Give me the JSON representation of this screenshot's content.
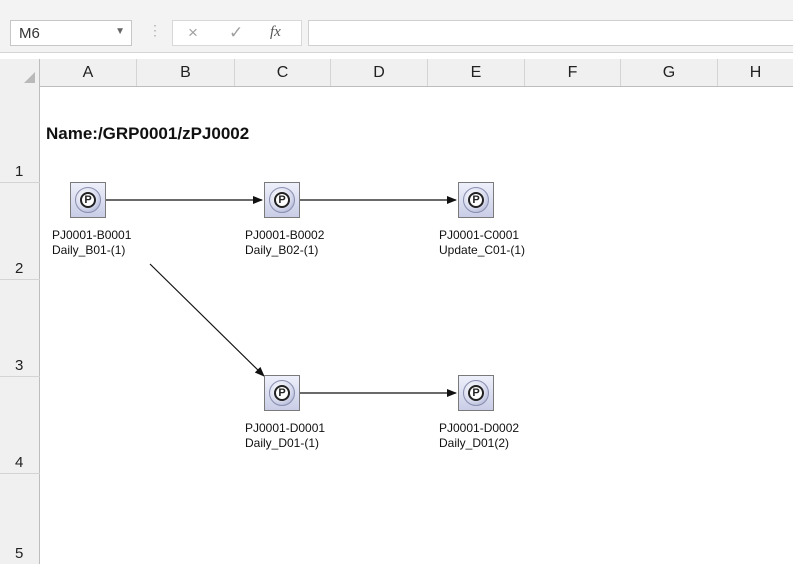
{
  "formula_bar": {
    "name_box": "M6",
    "cancel_icon": "×",
    "enter_icon": "✓",
    "fx_label": "fx",
    "formula_value": ""
  },
  "columns": [
    "A",
    "B",
    "C",
    "D",
    "E",
    "F",
    "G",
    "H"
  ],
  "rows": [
    "1",
    "2",
    "3",
    "4",
    "5"
  ],
  "sheet": {
    "title": "Name:/GRP0001/zPJ0002",
    "nodes": [
      {
        "id": "PJ0001-B0001",
        "name": "Daily_B01-(1)",
        "icon": "P"
      },
      {
        "id": "PJ0001-B0002",
        "name": "Daily_B02-(1)",
        "icon": "P"
      },
      {
        "id": "PJ0001-C0001",
        "name": "Update_C01-(1)",
        "icon": "P"
      },
      {
        "id": "PJ0001-D0001",
        "name": "Daily_D01-(1)",
        "icon": "P"
      },
      {
        "id": "PJ0001-D0002",
        "name": "Daily_D01(2)",
        "icon": "P"
      }
    ]
  }
}
